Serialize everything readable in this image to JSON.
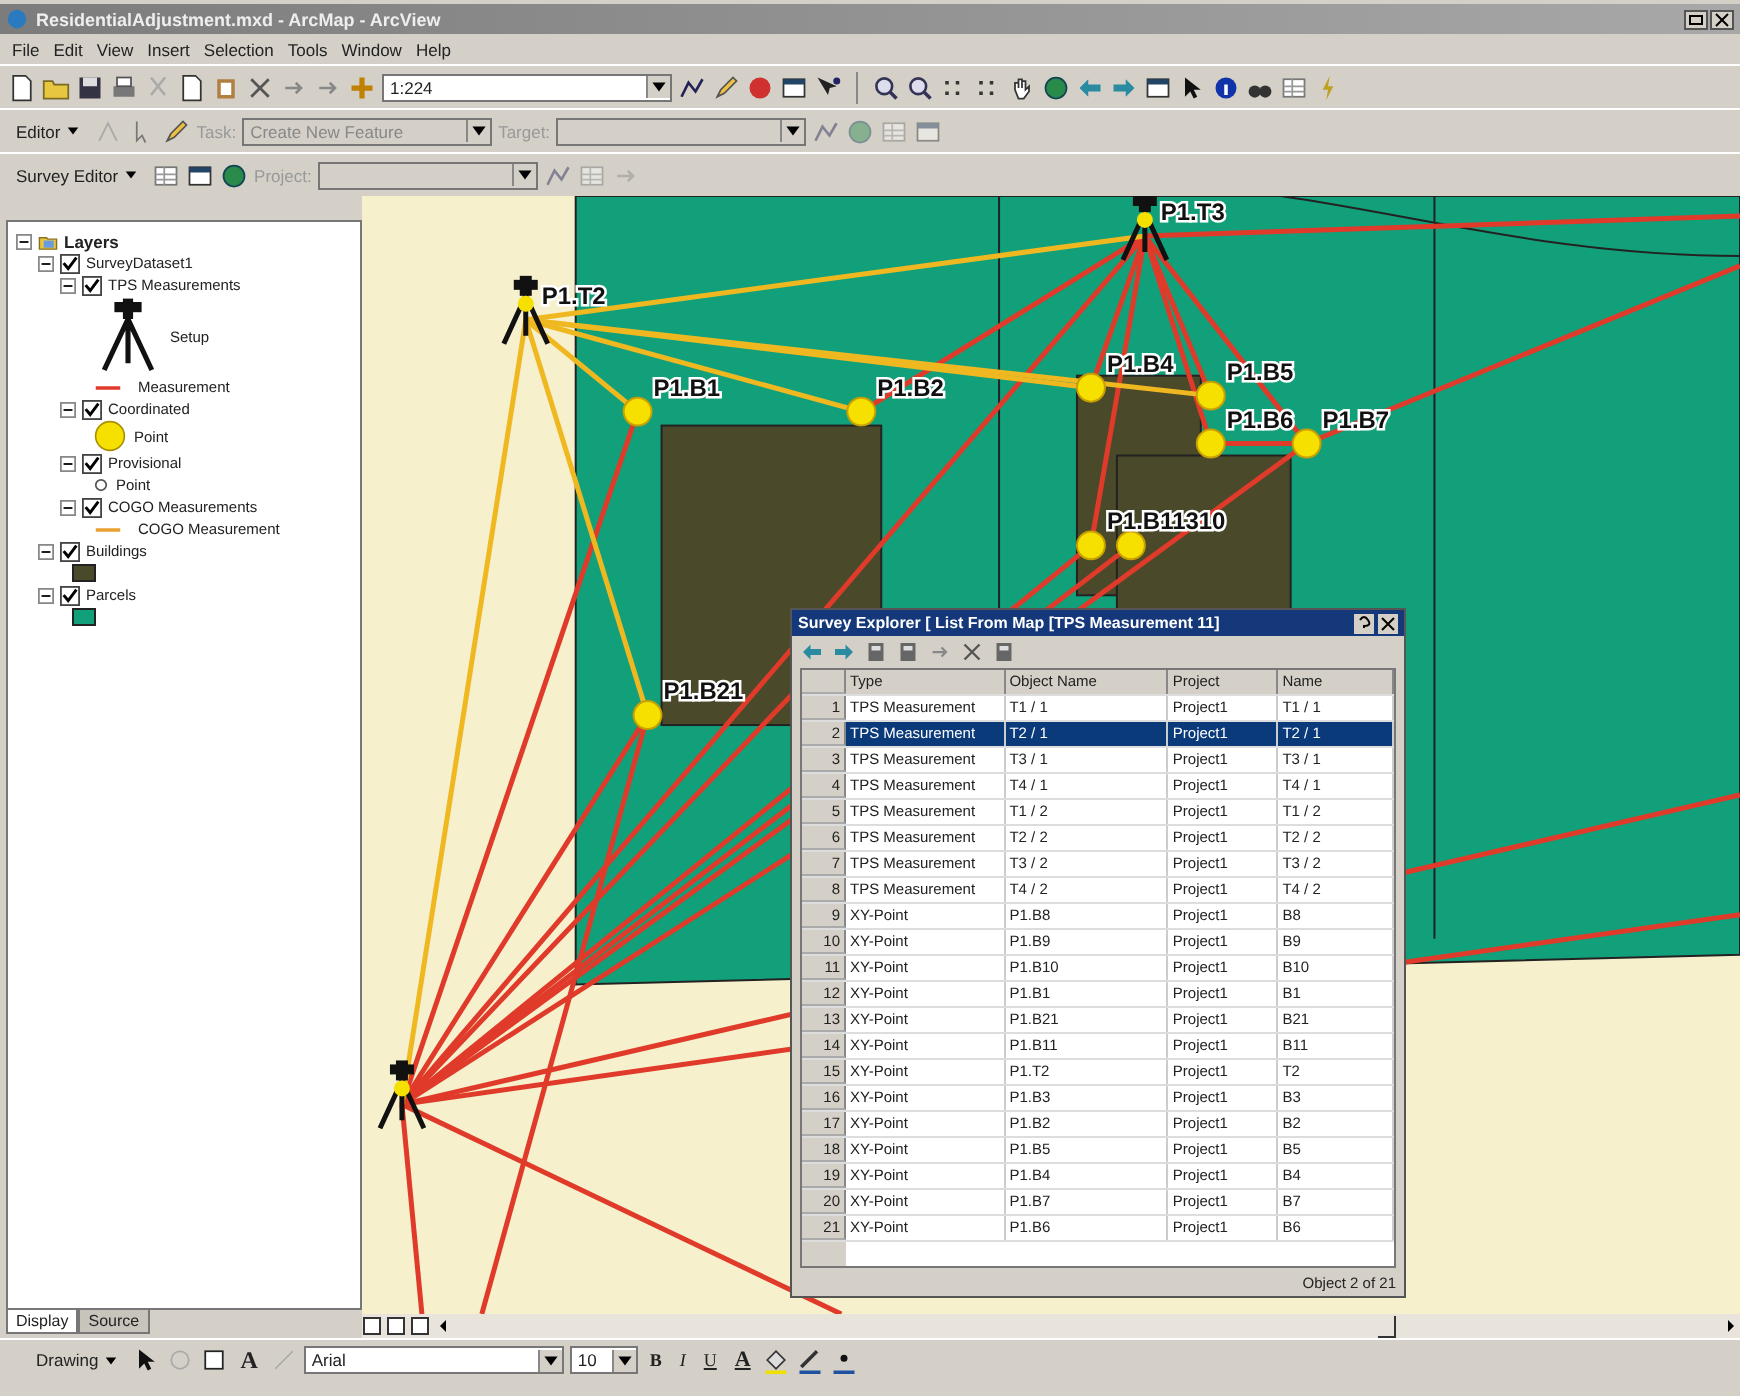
{
  "window": {
    "title": "ResidentialAdjustment.mxd - ArcMap - ArcView"
  },
  "menu": [
    "File",
    "Edit",
    "View",
    "Insert",
    "Selection",
    "Tools",
    "Window",
    "Help"
  ],
  "standard_toolbar": {
    "scale": "1:224"
  },
  "editor_toolbar": {
    "menu": "Editor",
    "task_label": "Task:",
    "task_value": "Create New Feature",
    "target_label": "Target:",
    "disabled": true
  },
  "survey_toolbar": {
    "menu": "Survey Editor",
    "project_label": "Project:",
    "disabled": true
  },
  "toc": {
    "root": {
      "label": "Layers",
      "expanded": true,
      "children": [
        {
          "label": "SurveyDataset1",
          "checked": true,
          "expanded": true,
          "children": [
            {
              "label": "TPS Measurements",
              "checked": true,
              "expanded": true,
              "legend": [
                {
                  "kind": "tripod",
                  "label": "Setup"
                },
                {
                  "kind": "line",
                  "label": "Measurement",
                  "color": "#e03a2a"
                }
              ]
            },
            {
              "label": "Coordinated",
              "checked": true,
              "expanded": true,
              "legend": [
                {
                  "kind": "circle",
                  "label": "Point",
                  "color": "#f5e000"
                }
              ]
            },
            {
              "label": "Provisional",
              "checked": true,
              "expanded": true,
              "legend": [
                {
                  "kind": "ring",
                  "label": "Point",
                  "color": "#555555"
                }
              ]
            },
            {
              "label": "COGO Measurements",
              "checked": true,
              "expanded": true,
              "legend": [
                {
                  "kind": "line",
                  "label": "COGO Measurement",
                  "color": "#e8a030"
                }
              ]
            }
          ]
        },
        {
          "label": "Buildings",
          "checked": true,
          "expanded": true,
          "legend": [
            {
              "kind": "swatch",
              "color": "#4a4a2a"
            }
          ]
        },
        {
          "label": "Parcels",
          "checked": true,
          "expanded": true,
          "legend": [
            {
              "kind": "swatch",
              "color": "#12a07a"
            }
          ]
        }
      ]
    },
    "tabs": [
      {
        "label": "Display",
        "selected": true
      },
      {
        "label": "Source",
        "selected": false
      }
    ]
  },
  "map": {
    "points": [
      {
        "kind": "setup",
        "label": "P1.T2"
      },
      {
        "kind": "setup",
        "label": "P1.T3"
      },
      {
        "kind": "setup"
      },
      {
        "kind": "point",
        "label": "P1.B1"
      },
      {
        "kind": "point",
        "label": "P1.B2"
      },
      {
        "kind": "point",
        "label": "P1.B4"
      },
      {
        "kind": "point",
        "label": "P1.B5"
      },
      {
        "kind": "point",
        "label": "P1.B6"
      },
      {
        "kind": "point",
        "label": "P1.B7"
      },
      {
        "kind": "point",
        "label": "P1.B11310"
      },
      {
        "kind": "point"
      },
      {
        "kind": "point",
        "label": "P1.B21"
      }
    ]
  },
  "survey_explorer": {
    "title": "Survey Explorer [ List From Map [TPS Measurement 11]",
    "columns": [
      "Type",
      "Object Name",
      "Project",
      "Name"
    ],
    "rows": [
      {
        "num": "1",
        "cells": [
          "TPS Measurement",
          "T1 / 1",
          "Project1",
          "T1 / 1"
        ],
        "selected": false
      },
      {
        "num": "2",
        "cells": [
          "TPS Measurement",
          "T2 / 1",
          "Project1",
          "T2 / 1"
        ],
        "selected": true
      },
      {
        "num": "3",
        "cells": [
          "TPS Measurement",
          "T3 / 1",
          "Project1",
          "T3 / 1"
        ],
        "selected": false
      },
      {
        "num": "4",
        "cells": [
          "TPS Measurement",
          "T4 / 1",
          "Project1",
          "T4 / 1"
        ],
        "selected": false
      },
      {
        "num": "5",
        "cells": [
          "TPS Measurement",
          "T1 / 2",
          "Project1",
          "T1 / 2"
        ],
        "selected": false
      },
      {
        "num": "6",
        "cells": [
          "TPS Measurement",
          "T2 / 2",
          "Project1",
          "T2 / 2"
        ],
        "selected": false
      },
      {
        "num": "7",
        "cells": [
          "TPS Measurement",
          "T3 / 2",
          "Project1",
          "T3 / 2"
        ],
        "selected": false
      },
      {
        "num": "8",
        "cells": [
          "TPS Measurement",
          "T4 / 2",
          "Project1",
          "T4 / 2"
        ],
        "selected": false
      },
      {
        "num": "9",
        "cells": [
          "XY-Point",
          "P1.B8",
          "Project1",
          "B8"
        ],
        "selected": false
      },
      {
        "num": "10",
        "cells": [
          "XY-Point",
          "P1.B9",
          "Project1",
          "B9"
        ],
        "selected": false
      },
      {
        "num": "11",
        "cells": [
          "XY-Point",
          "P1.B10",
          "Project1",
          "B10"
        ],
        "selected": false
      },
      {
        "num": "12",
        "cells": [
          "XY-Point",
          "P1.B1",
          "Project1",
          "B1"
        ],
        "selected": false
      },
      {
        "num": "13",
        "cells": [
          "XY-Point",
          "P1.B21",
          "Project1",
          "B21"
        ],
        "selected": false
      },
      {
        "num": "14",
        "cells": [
          "XY-Point",
          "P1.B11",
          "Project1",
          "B11"
        ],
        "selected": false
      },
      {
        "num": "15",
        "cells": [
          "XY-Point",
          "P1.T2",
          "Project1",
          "T2"
        ],
        "selected": false
      },
      {
        "num": "16",
        "cells": [
          "XY-Point",
          "P1.B3",
          "Project1",
          "B3"
        ],
        "selected": false
      },
      {
        "num": "17",
        "cells": [
          "XY-Point",
          "P1.B2",
          "Project1",
          "B2"
        ],
        "selected": false
      },
      {
        "num": "18",
        "cells": [
          "XY-Point",
          "P1.B5",
          "Project1",
          "B5"
        ],
        "selected": false
      },
      {
        "num": "19",
        "cells": [
          "XY-Point",
          "P1.B4",
          "Project1",
          "B4"
        ],
        "selected": false
      },
      {
        "num": "20",
        "cells": [
          "XY-Point",
          "P1.B7",
          "Project1",
          "B7"
        ],
        "selected": false
      },
      {
        "num": "21",
        "cells": [
          "XY-Point",
          "P1.B6",
          "Project1",
          "B6"
        ],
        "selected": false
      }
    ],
    "status": "Object 2 of 21"
  },
  "drawing_toolbar": {
    "menu": "Drawing",
    "text_tool": "A",
    "font": "Arial",
    "size": "10",
    "format_buttons": [
      "B",
      "I",
      "U"
    ],
    "font_color": "A"
  }
}
